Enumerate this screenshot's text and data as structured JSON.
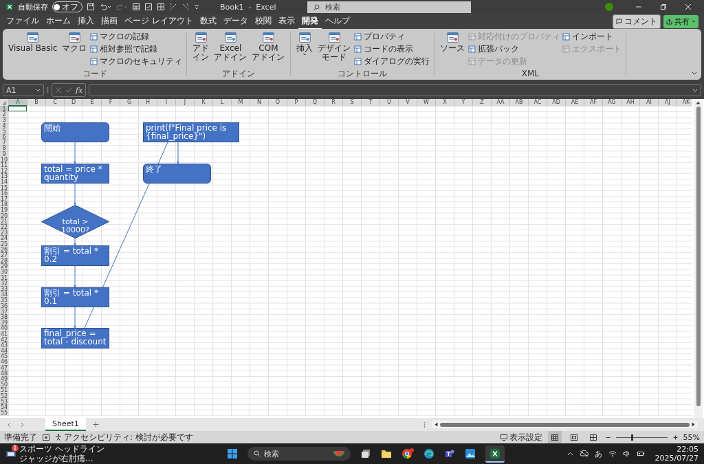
{
  "title_bar": {
    "autosave_label": "自動保存",
    "autosave_toggle": {
      "label": "オフ",
      "on": false
    },
    "redo_enabled": false,
    "document_title": "Book1  -  Excel",
    "search_placeholder": "検索"
  },
  "menu_tabs": [
    {
      "label": "ファイル",
      "selected": false
    },
    {
      "label": "ホーム",
      "selected": false
    },
    {
      "label": "挿入",
      "selected": false
    },
    {
      "label": "描画",
      "selected": false
    },
    {
      "label": "ページ レイアウト",
      "selected": false
    },
    {
      "label": "数式",
      "selected": false
    },
    {
      "label": "データ",
      "selected": false
    },
    {
      "label": "校閲",
      "selected": false
    },
    {
      "label": "表示",
      "selected": false
    },
    {
      "label": "開発",
      "selected": true
    },
    {
      "label": "ヘルプ",
      "selected": false
    }
  ],
  "comment_button": "コメント",
  "share_button": "共有",
  "ribbon": {
    "groups": [
      {
        "label": "コード",
        "columns": [
          {
            "kind": "large",
            "lines": [
              "Visual Basic"
            ],
            "dropdown": false
          },
          {
            "kind": "large",
            "lines": [
              "マクロ"
            ],
            "dropdown": false
          },
          {
            "kind": "small",
            "items": [
              {
                "label": "マクロの記録",
                "disabled": false
              },
              {
                "label": "相対参照で記録",
                "disabled": false
              },
              {
                "label": "マクロのセキュリティ",
                "disabled": false
              }
            ]
          }
        ]
      },
      {
        "label": "アドイン",
        "columns": [
          {
            "kind": "large",
            "lines": [
              "アド",
              "イン"
            ],
            "dropdown": false
          },
          {
            "kind": "large",
            "lines": [
              "Excel",
              "アドイン"
            ],
            "dropdown": false
          },
          {
            "kind": "large",
            "lines": [
              "COM",
              "アドイン"
            ],
            "dropdown": false
          }
        ]
      },
      {
        "label": "コントロール",
        "columns": [
          {
            "kind": "large",
            "lines": [
              "挿入"
            ],
            "dropdown": true
          },
          {
            "kind": "large",
            "lines": [
              "デザイン",
              "モード"
            ],
            "dropdown": false
          },
          {
            "kind": "small",
            "items": [
              {
                "label": "プロパティ",
                "disabled": false
              },
              {
                "label": "コードの表示",
                "disabled": false
              },
              {
                "label": "ダイアログの実行",
                "disabled": false
              }
            ]
          }
        ]
      },
      {
        "label": "XML",
        "columns": [
          {
            "kind": "large",
            "lines": [
              "ソース"
            ],
            "dropdown": false
          },
          {
            "kind": "small",
            "items": [
              {
                "label": "対応付けのプロパティ",
                "disabled": true
              },
              {
                "label": "拡張パック",
                "disabled": false
              },
              {
                "label": "データの更新",
                "disabled": true
              }
            ]
          },
          {
            "kind": "small",
            "items": [
              {
                "label": "インポート",
                "disabled": false
              },
              {
                "label": "エクスポート",
                "disabled": true
              }
            ]
          }
        ]
      }
    ]
  },
  "formula_bar": {
    "name_box": "A1",
    "function_label": "fx"
  },
  "sheet": {
    "columns": [
      {
        "label": "A",
        "selected": true
      },
      {
        "label": "B",
        "selected": false
      },
      {
        "label": "C",
        "selected": false
      },
      {
        "label": "D",
        "selected": false
      },
      {
        "label": "E",
        "selected": false
      },
      {
        "label": "F",
        "selected": false
      },
      {
        "label": "G",
        "selected": false
      },
      {
        "label": "H",
        "selected": false
      },
      {
        "label": "I",
        "selected": false
      },
      {
        "label": "J",
        "selected": false
      },
      {
        "label": "K",
        "selected": false
      },
      {
        "label": "L",
        "selected": false
      },
      {
        "label": "M",
        "selected": false
      },
      {
        "label": "N",
        "selected": false
      },
      {
        "label": "O",
        "selected": false
      },
      {
        "label": "P",
        "selected": false
      },
      {
        "label": "Q",
        "selected": false
      },
      {
        "label": "R",
        "selected": false
      },
      {
        "label": "S",
        "selected": false
      },
      {
        "label": "T",
        "selected": false
      },
      {
        "label": "U",
        "selected": false
      },
      {
        "label": "V",
        "selected": false
      },
      {
        "label": "W",
        "selected": false
      },
      {
        "label": "X",
        "selected": false
      },
      {
        "label": "Y",
        "selected": false
      },
      {
        "label": "Z",
        "selected": false
      },
      {
        "label": "AA",
        "selected": false
      },
      {
        "label": "AB",
        "selected": false
      },
      {
        "label": "AC",
        "selected": false
      },
      {
        "label": "AD",
        "selected": false
      },
      {
        "label": "AE",
        "selected": false
      },
      {
        "label": "AF",
        "selected": false
      },
      {
        "label": "AG",
        "selected": false
      },
      {
        "label": "AH",
        "selected": false
      },
      {
        "label": "AI",
        "selected": false
      },
      {
        "label": "AJ",
        "selected": false
      },
      {
        "label": "AK",
        "selected": false
      }
    ],
    "rows": [
      {
        "label": "1",
        "selected": true
      },
      {
        "label": "2",
        "selected": false
      },
      {
        "label": "3",
        "selected": false
      },
      {
        "label": "4",
        "selected": false
      },
      {
        "label": "5",
        "selected": false
      },
      {
        "label": "6",
        "selected": false
      },
      {
        "label": "7",
        "selected": false
      },
      {
        "label": "8",
        "selected": false
      },
      {
        "label": "9",
        "selected": false
      },
      {
        "label": "10",
        "selected": false
      },
      {
        "label": "11",
        "selected": false
      },
      {
        "label": "12",
        "selected": false
      },
      {
        "label": "13",
        "selected": false
      },
      {
        "label": "14",
        "selected": false
      },
      {
        "label": "15",
        "selected": false
      },
      {
        "label": "16",
        "selected": false
      },
      {
        "label": "17",
        "selected": false
      },
      {
        "label": "18",
        "selected": false
      },
      {
        "label": "19",
        "selected": false
      },
      {
        "label": "20",
        "selected": false
      },
      {
        "label": "21",
        "selected": false
      },
      {
        "label": "22",
        "selected": false
      },
      {
        "label": "23",
        "selected": false
      },
      {
        "label": "24",
        "selected": false
      },
      {
        "label": "25",
        "selected": false
      },
      {
        "label": "26",
        "selected": false
      },
      {
        "label": "27",
        "selected": false
      },
      {
        "label": "28",
        "selected": false
      },
      {
        "label": "29",
        "selected": false
      },
      {
        "label": "30",
        "selected": false
      },
      {
        "label": "31",
        "selected": false
      },
      {
        "label": "32",
        "selected": false
      },
      {
        "label": "33",
        "selected": false
      },
      {
        "label": "34",
        "selected": false
      },
      {
        "label": "35",
        "selected": false
      },
      {
        "label": "36",
        "selected": false
      },
      {
        "label": "37",
        "selected": false
      },
      {
        "label": "38",
        "selected": false
      },
      {
        "label": "39",
        "selected": false
      },
      {
        "label": "40",
        "selected": false
      },
      {
        "label": "41",
        "selected": false
      },
      {
        "label": "42",
        "selected": false
      },
      {
        "label": "43",
        "selected": false
      },
      {
        "label": "44",
        "selected": false
      },
      {
        "label": "45",
        "selected": false
      },
      {
        "label": "46",
        "selected": false
      },
      {
        "label": "47",
        "selected": false
      },
      {
        "label": "48",
        "selected": false
      },
      {
        "label": "49",
        "selected": false
      },
      {
        "label": "50",
        "selected": false
      },
      {
        "label": "51",
        "selected": false
      },
      {
        "label": "52",
        "selected": false
      },
      {
        "label": "53",
        "selected": false
      },
      {
        "label": "54",
        "selected": false
      },
      {
        "label": "55",
        "selected": false
      }
    ]
  },
  "flowchart": {
    "nodes": [
      {
        "kind": "terminal",
        "text": "開始"
      },
      {
        "kind": "process",
        "text": "total = price * quantity"
      },
      {
        "kind": "decision",
        "text": "total > 10000?"
      },
      {
        "kind": "process",
        "text": "割引 = total * 0.2"
      },
      {
        "kind": "process",
        "text": "割引 = total * 0.1"
      },
      {
        "kind": "process",
        "text": "final_price = total - discount"
      },
      {
        "kind": "process",
        "text": "print(f\"Final price is {final_price}\")"
      },
      {
        "kind": "terminal",
        "text": "終了"
      }
    ]
  },
  "sheet_tabs": [
    {
      "label": "Sheet1",
      "selected": true
    }
  ],
  "status_bar": {
    "ready": "準備完了",
    "accessibility": "アクセシビリティ: 検討が必要です",
    "display_settings": "表示設定",
    "views": [
      {
        "selected": true
      },
      {
        "selected": false
      },
      {
        "selected": false
      }
    ],
    "zoom": {
      "level": 0.32,
      "reading": "55%"
    }
  },
  "taskbar": {
    "news_badge": "1",
    "news_title": "スポーツ ヘッドライン",
    "news_text": "ジャッジが右肘痛...",
    "search_placeholder": "検索",
    "ime": "あ",
    "time": "22:05",
    "date": "2025/07/27"
  }
}
